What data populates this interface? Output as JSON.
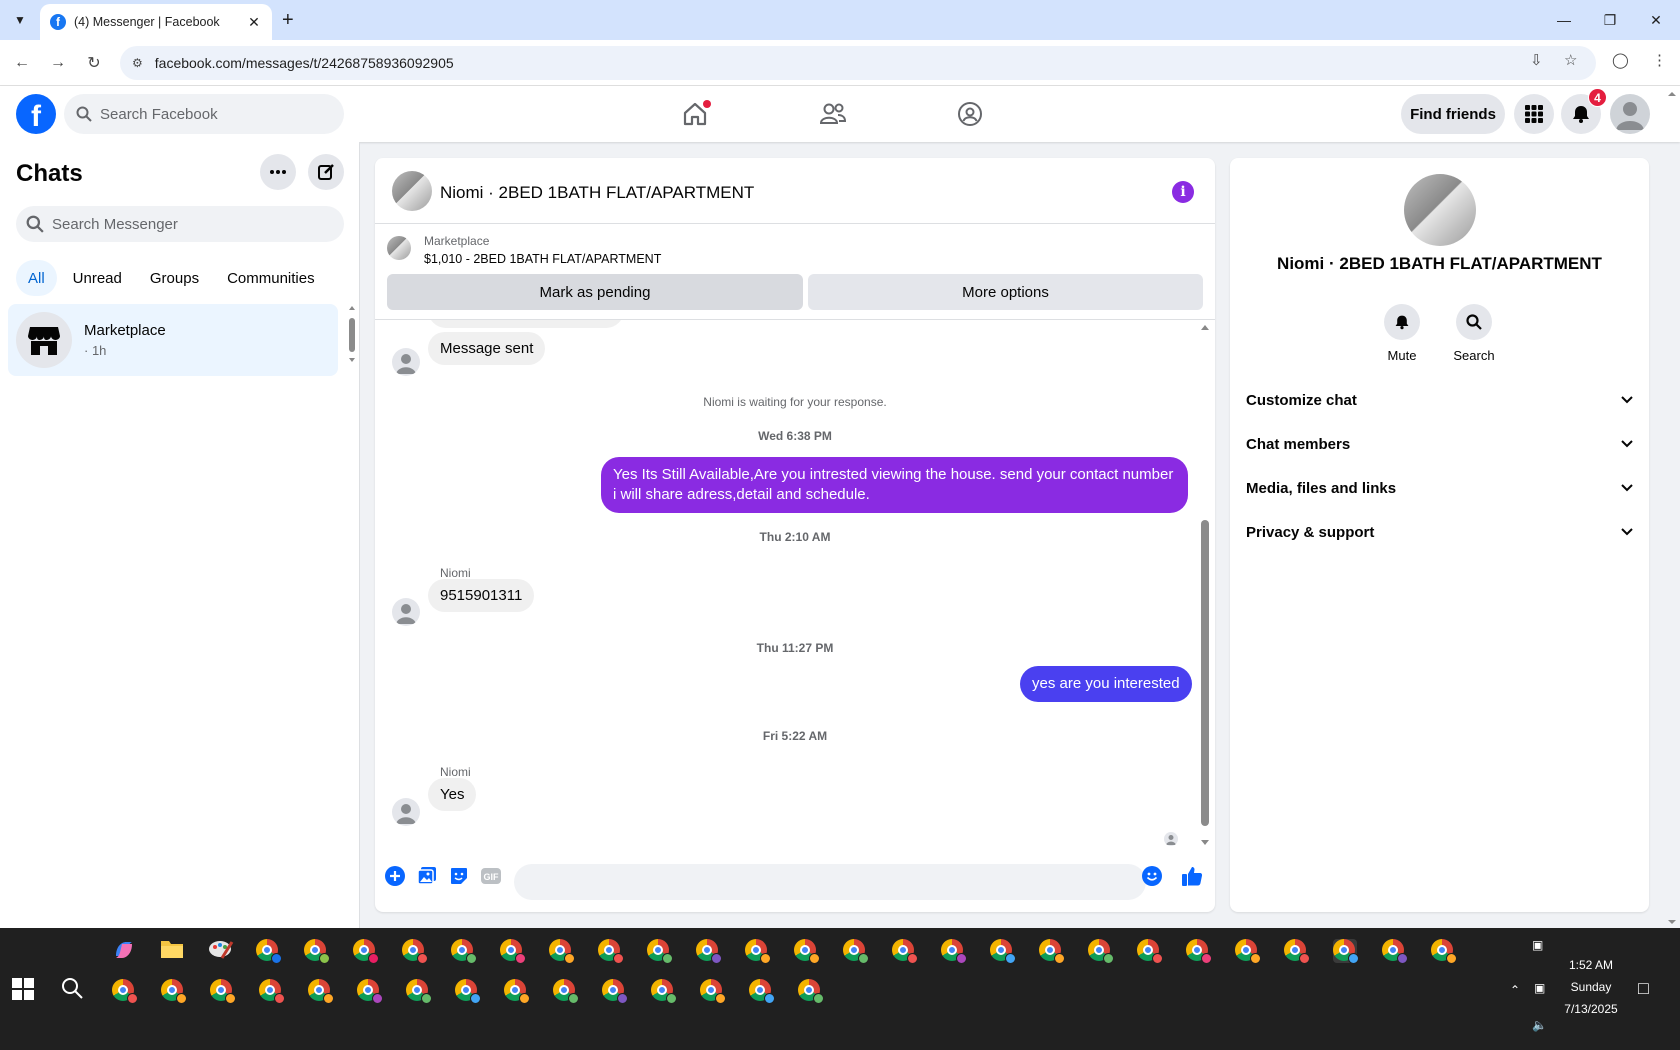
{
  "browser": {
    "tab_title": "(4) Messenger | Facebook",
    "url": "facebook.com/messages/t/24268758936092905"
  },
  "header": {
    "search_placeholder": "Search Facebook",
    "find_friends": "Find friends",
    "notifications_count": "4"
  },
  "sidebar": {
    "title": "Chats",
    "search_placeholder": "Search Messenger",
    "filters": [
      "All",
      "Unread",
      "Groups",
      "Communities"
    ],
    "active_filter": "All",
    "conversations": [
      {
        "name": "Marketplace",
        "time": "· 1h"
      }
    ]
  },
  "chat": {
    "title": "Niomi · 2BED 1BATH FLAT/APARTMENT",
    "listing_label": "Marketplace",
    "listing_price": "$1,010 - 2BED 1BATH FLAT/APARTMENT",
    "mark_pending": "Mark as pending",
    "more_options": "More options",
    "messages": {
      "sent_notice": "Message sent",
      "waiting": "Niomi is waiting for your response.",
      "stamp1": "Wed 6:38 PM",
      "out1": "Yes Its Still Available,Are you intrested viewing the house. send your contact number i will share adress,detail and schedule.",
      "stamp2": "Thu 2:10 AM",
      "sender2": "Niomi",
      "in2": "9515901311",
      "stamp3": "Thu 11:27 PM",
      "out3": "yes are you interested",
      "stamp4": "Fri 5:22 AM",
      "sender4": "Niomi",
      "in4": "Yes"
    },
    "colors": {
      "out1": "#8a2be2",
      "out3": "#4a40f0",
      "accent": "#8a2be2"
    }
  },
  "info_panel": {
    "name": "Niomi · 2BED 1BATH FLAT/APARTMENT",
    "mute": "Mute",
    "search": "Search",
    "sections": [
      "Customize chat",
      "Chat members",
      "Media, files and links",
      "Privacy & support"
    ]
  },
  "taskbar": {
    "time": "1:52 AM",
    "day": "Sunday",
    "date": "7/13/2025"
  }
}
